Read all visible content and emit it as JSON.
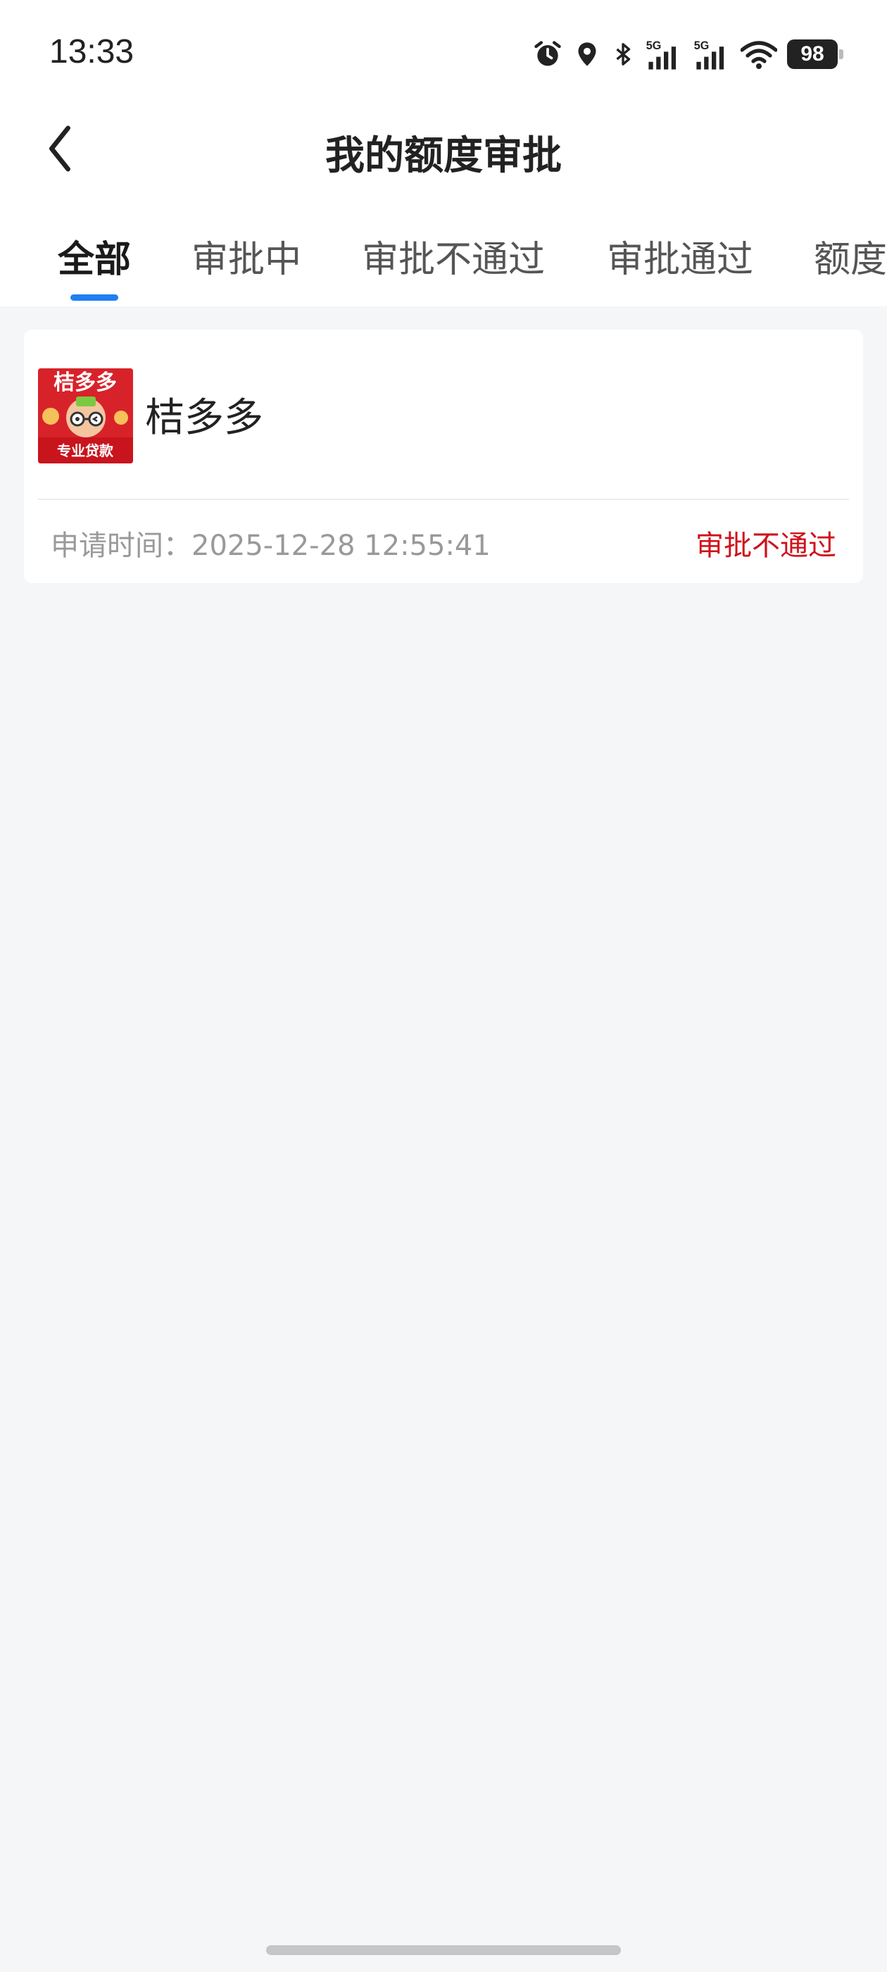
{
  "status_bar": {
    "time": "13:33",
    "icons": [
      "alarm-icon",
      "location-icon",
      "bluetooth-icon",
      "signal-5g-icon",
      "signal-5g-icon",
      "wifi-icon"
    ],
    "battery": "98"
  },
  "header": {
    "back_icon": "chevron-left-icon",
    "title": "我的额度审批"
  },
  "tabs": [
    {
      "label": "全部",
      "active": true
    },
    {
      "label": "审批中",
      "active": false
    },
    {
      "label": "审批不通过",
      "active": false
    },
    {
      "label": "审批通过",
      "active": false
    },
    {
      "label": "额度",
      "active": false
    }
  ],
  "records": [
    {
      "logo": {
        "text_top": "桔多多",
        "text_bottom": "专业贷款",
        "brand_color": "#d8222a"
      },
      "name": "桔多多",
      "apply_time_label": "申请时间：",
      "apply_time": "2025-12-28 12:55:41",
      "status": "审批不通过",
      "status_color": "#d0121b"
    }
  ],
  "colors": {
    "accent": "#1f7ff0",
    "background": "#f5f6f8",
    "rejected": "#d0121b"
  }
}
